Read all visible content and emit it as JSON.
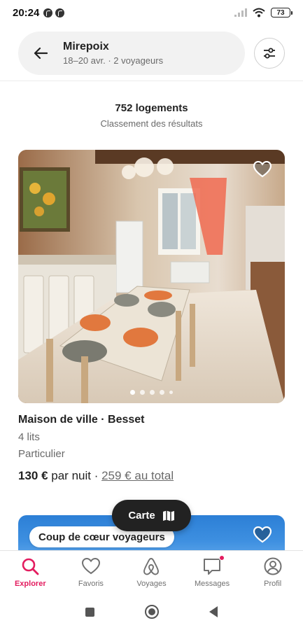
{
  "status_bar": {
    "time": "20:24",
    "battery": "73",
    "left_icons": [
      "facebook-icon",
      "facebook-icon"
    ],
    "right_icons": [
      "signal-icon",
      "wifi-icon",
      "battery-icon"
    ]
  },
  "search": {
    "title": "Mirepoix",
    "subtitle": "18–20 avr. · 2 voyageurs",
    "back_icon": "arrow-left-icon",
    "filter_icon": "filter-sliders-icon"
  },
  "results": {
    "count": "752 logements",
    "sort_label": "Classement des résultats"
  },
  "listing": {
    "title": "Maison de ville · Besset",
    "beds": "4 lits",
    "host_type": "Particulier",
    "price": "130 €",
    "price_unit": " par nuit",
    "separator": " · ",
    "total": "259 € au total",
    "photo_count": 5,
    "active_photo": 1,
    "photo_description_icons": [
      "heart-outline-icon"
    ]
  },
  "listing2": {
    "badge": "Coup de cœur voyageurs"
  },
  "map_button": {
    "label": "Carte",
    "icon": "map-icon"
  },
  "bottom_nav": {
    "items": [
      {
        "label": "Explorer",
        "icon": "search-icon",
        "active": true
      },
      {
        "label": "Favoris",
        "icon": "heart-icon",
        "active": false
      },
      {
        "label": "Voyages",
        "icon": "airbnb-logo-icon",
        "active": false
      },
      {
        "label": "Messages",
        "icon": "message-icon",
        "active": false,
        "notification": true
      },
      {
        "label": "Profil",
        "icon": "profile-icon",
        "active": false
      }
    ]
  },
  "colors": {
    "accent": "#e31c5f",
    "text": "#222222",
    "muted": "#6a6a6a",
    "map_button_bg": "#222222"
  }
}
